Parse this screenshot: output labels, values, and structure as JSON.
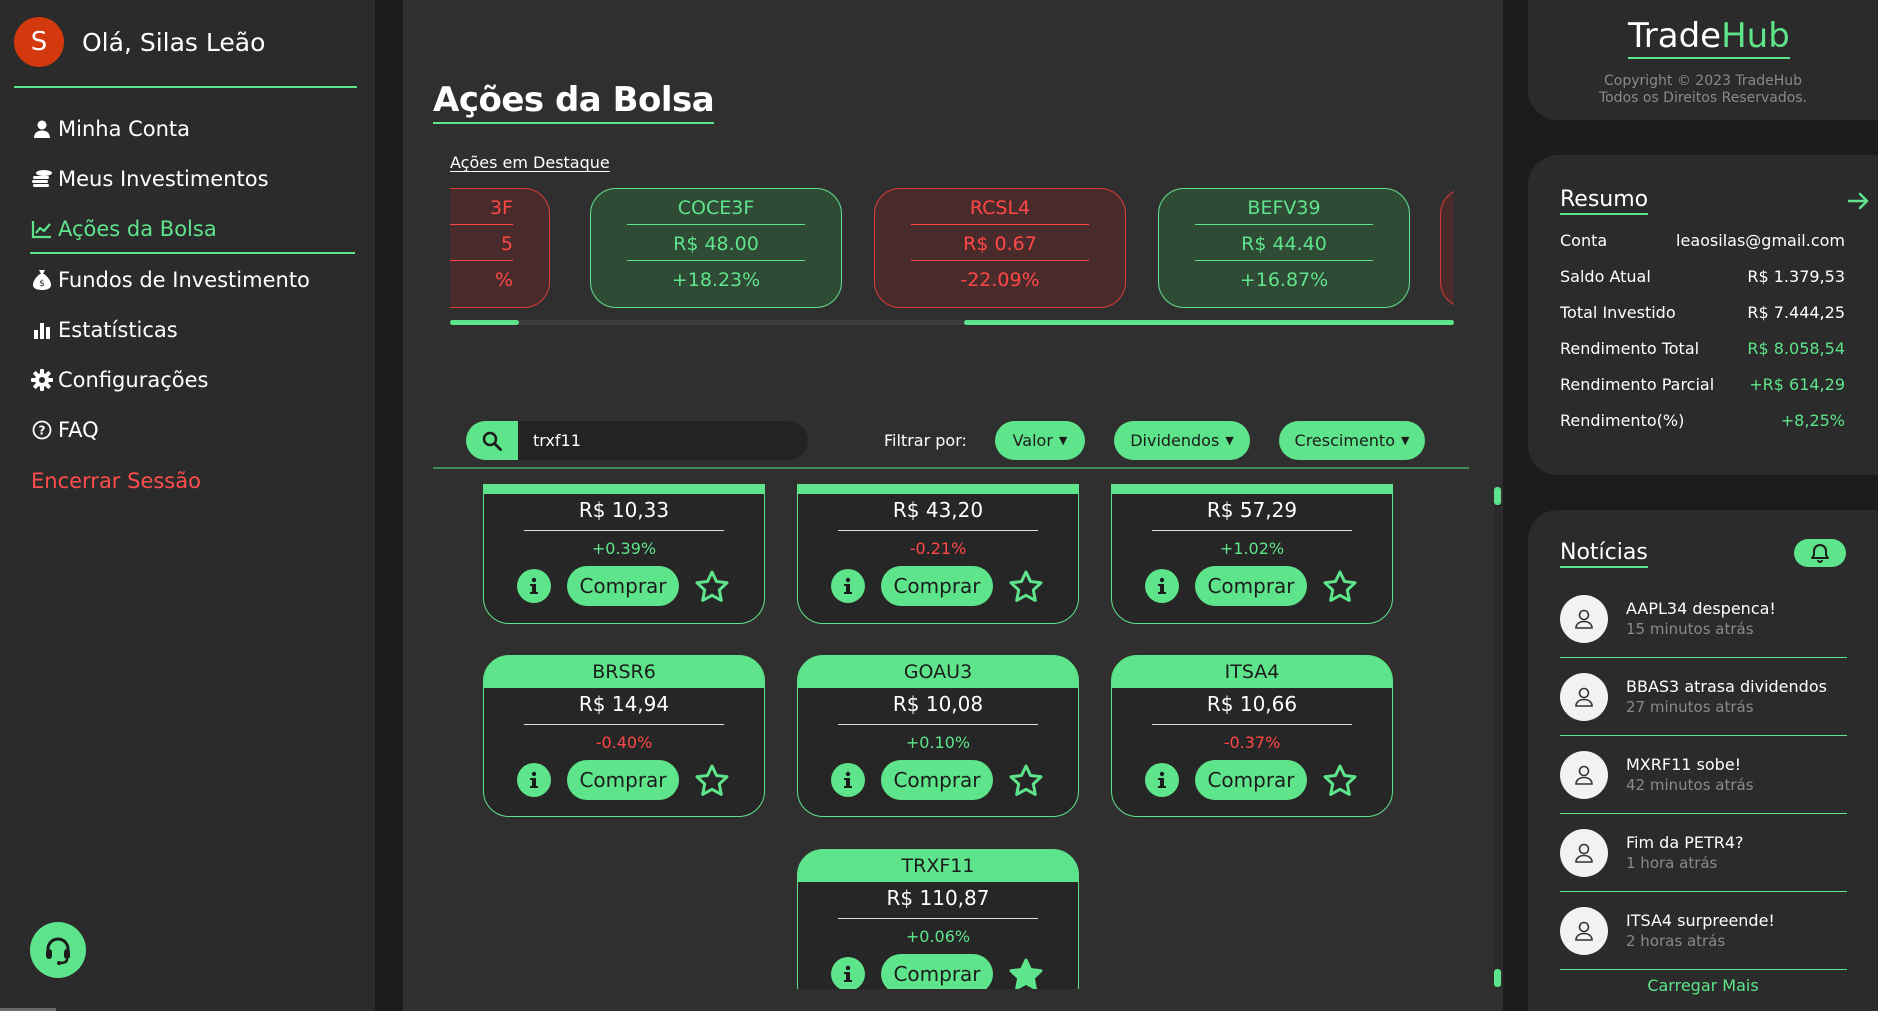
{
  "sidebar": {
    "avatar_letter": "S",
    "greeting": "Olá, Silas Leão",
    "items": [
      {
        "label": "Minha Conta",
        "icon": "user-icon"
      },
      {
        "label": "Meus Investimentos",
        "icon": "coins-icon"
      },
      {
        "label": "Ações da Bolsa",
        "icon": "chart-line-icon",
        "active": true
      },
      {
        "label": "Fundos de Investimento",
        "icon": "money-bag-icon"
      },
      {
        "label": "Estatísticas",
        "icon": "bar-chart-icon"
      },
      {
        "label": "Configurações",
        "icon": "gear-icon"
      },
      {
        "label": "FAQ",
        "icon": "question-icon"
      }
    ],
    "logout": "Encerrar Sessão",
    "support_icon": "headset-icon"
  },
  "main": {
    "title": "Ações da Bolsa",
    "featured_label": "Ações em Destaque",
    "featured": [
      {
        "ticker": "3F",
        "price": "5",
        "change": "%",
        "trend": "down"
      },
      {
        "ticker": "COCE3F",
        "price": "R$ 48.00",
        "change": "+18.23%",
        "trend": "up"
      },
      {
        "ticker": "RCSL4",
        "price": "R$ 0.67",
        "change": "-22.09%",
        "trend": "down"
      },
      {
        "ticker": "BEFV39",
        "price": "R$ 44.40",
        "change": "+16.87%",
        "trend": "up"
      },
      {
        "ticker": "",
        "price": "",
        "change": "",
        "trend": "down"
      }
    ],
    "search": {
      "value": "trxf11",
      "placeholder": ""
    },
    "filter_label": "Filtrar por:",
    "filters": [
      "Valor",
      "Dividendos",
      "Crescimento"
    ],
    "buy_label": "Comprar",
    "stocks": [
      {
        "ticker": "",
        "price": "R$ 10,33",
        "change": "+0.39%",
        "trend": "up",
        "fav": false
      },
      {
        "ticker": "",
        "price": "R$ 43,20",
        "change": "-0.21%",
        "trend": "down",
        "fav": false
      },
      {
        "ticker": "",
        "price": "R$ 57,29",
        "change": "+1.02%",
        "trend": "up",
        "fav": false
      },
      {
        "ticker": "BRSR6",
        "price": "R$ 14,94",
        "change": "-0.40%",
        "trend": "down",
        "fav": false
      },
      {
        "ticker": "GOAU3",
        "price": "R$ 10,08",
        "change": "+0.10%",
        "trend": "up",
        "fav": false
      },
      {
        "ticker": "ITSA4",
        "price": "R$ 10,66",
        "change": "-0.37%",
        "trend": "down",
        "fav": false
      },
      {
        "ticker": "TRXF11",
        "price": "R$ 110,87",
        "change": "+0.06%",
        "trend": "up",
        "fav": true
      }
    ]
  },
  "brand": {
    "name_a": "Trade",
    "name_b": "Hub",
    "copyright": "Copyright © 2023 TradeHub",
    "rights": "Todos os Direitos Reservados."
  },
  "summary": {
    "title": "Resumo",
    "rows": [
      {
        "label": "Conta",
        "value": "leaosilas@gmail.com",
        "green": false
      },
      {
        "label": "Saldo Atual",
        "value": "R$ 1.379,53",
        "green": false
      },
      {
        "label": "Total Investido",
        "value": "R$ 7.444,25",
        "green": false
      },
      {
        "label": "Rendimento Total",
        "value": "R$ 8.058,54",
        "green": true
      },
      {
        "label": "Rendimento Parcial",
        "value": "+R$ 614,29",
        "green": true
      },
      {
        "label": "Rendimento(%)",
        "value": "+8,25%",
        "green": true
      }
    ]
  },
  "news": {
    "title": "Notícias",
    "items": [
      {
        "title": "AAPL34 despenca!",
        "time": "15 minutos atrás"
      },
      {
        "title": "BBAS3 atrasa dividendos",
        "time": "27 minutos atrás"
      },
      {
        "title": "MXRF11 sobe!",
        "time": "42 minutos atrás"
      },
      {
        "title": "Fim da PETR4?",
        "time": "1 hora atrás"
      },
      {
        "title": "ITSA4 surpreende!",
        "time": "2 horas atrás"
      }
    ],
    "more": "Carregar Mais"
  },
  "colors": {
    "accent": "#5ee48a",
    "negative": "#ff4747",
    "background": "#2f2f2f"
  }
}
